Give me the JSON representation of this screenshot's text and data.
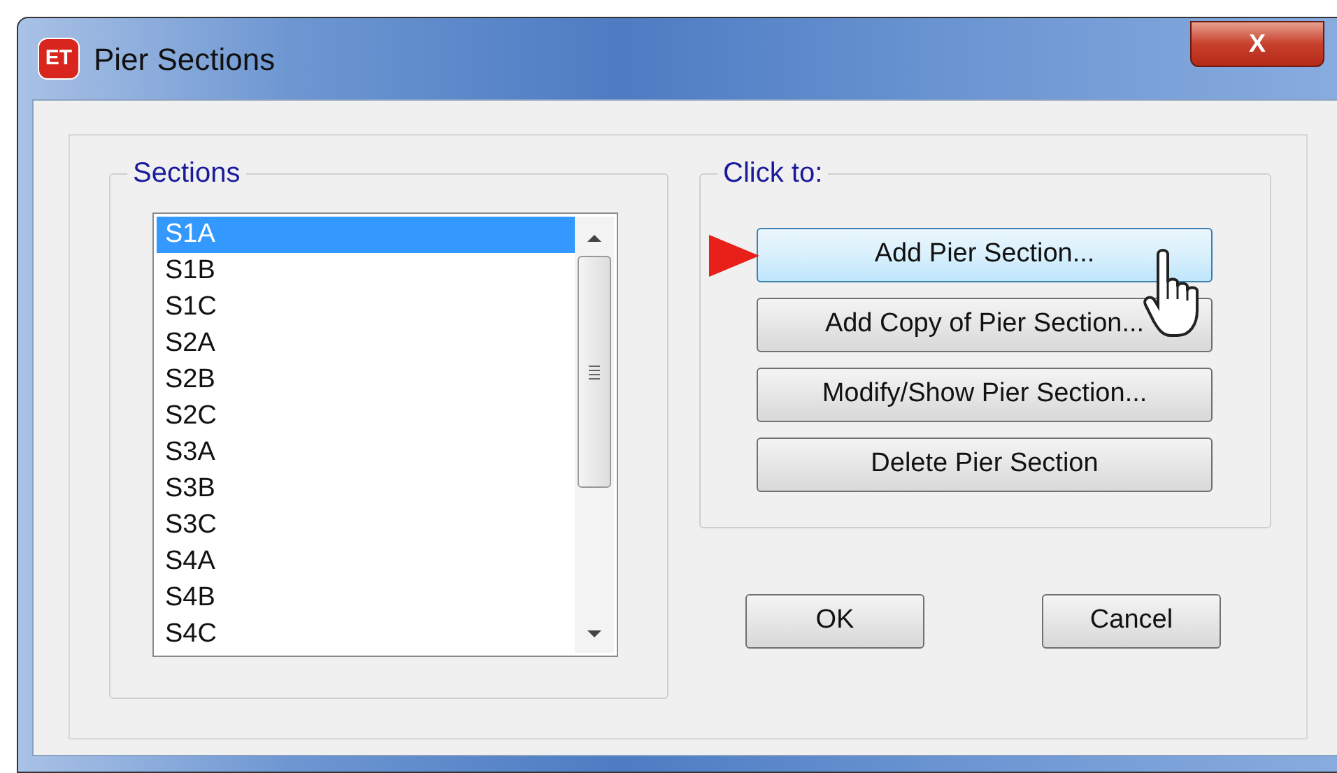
{
  "window": {
    "title": "Pier Sections",
    "app_badge": "ET",
    "close": "X"
  },
  "sections": {
    "label": "Sections",
    "items": [
      {
        "label": "S1A",
        "selected": true
      },
      {
        "label": "S1B",
        "selected": false
      },
      {
        "label": "S1C",
        "selected": false
      },
      {
        "label": "S2A",
        "selected": false
      },
      {
        "label": "S2B",
        "selected": false
      },
      {
        "label": "S2C",
        "selected": false
      },
      {
        "label": "S3A",
        "selected": false
      },
      {
        "label": "S3B",
        "selected": false
      },
      {
        "label": "S3C",
        "selected": false
      },
      {
        "label": "S4A",
        "selected": false
      },
      {
        "label": "S4B",
        "selected": false
      },
      {
        "label": "S4C",
        "selected": false
      }
    ]
  },
  "click_to": {
    "label": "Click to:",
    "buttons": [
      {
        "label": "Add Pier Section...",
        "highlighted": true
      },
      {
        "label": "Add Copy of Pier Section...",
        "highlighted": false
      },
      {
        "label": "Modify/Show Pier Section...",
        "highlighted": false
      },
      {
        "label": "Delete Pier Section",
        "highlighted": false
      }
    ]
  },
  "buttons": [
    "OK",
    "Cancel"
  ]
}
